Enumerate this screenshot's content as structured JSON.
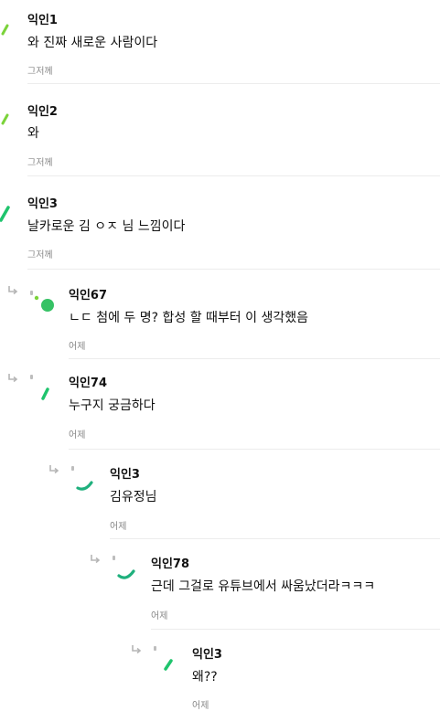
{
  "comments": [
    {
      "author": "익인1",
      "text": "와 진짜 새로운 사람이다",
      "time": "그저께",
      "depth": 0,
      "avatar_color": "#7bd33a"
    },
    {
      "author": "익인2",
      "text": "와",
      "time": "그저께",
      "depth": 0,
      "avatar_color": "#7bd33a"
    },
    {
      "author": "익인3",
      "text": "날카로운 김 ㅇㅈ 님 느낌이다",
      "time": "그저께",
      "depth": 0,
      "avatar_color": "#1fc46d"
    },
    {
      "author": "익인67",
      "text": "ㄴㄷ 첨에 두 명? 합성 할 때부터 이 생각했음",
      "time": "어제",
      "depth": 1,
      "avatar_color": "#36c265"
    },
    {
      "author": "익인74",
      "text": "누구지 궁금하다",
      "time": "어제",
      "depth": 1,
      "avatar_color": "#1fc46d"
    },
    {
      "author": "익인3",
      "text": "김유정님",
      "time": "어제",
      "depth": 2,
      "avatar_color": "#1fb07d"
    },
    {
      "author": "익인78",
      "text": "근데 그걸로 유튜브에서 싸움났더라ㅋㅋㅋ",
      "time": "어제",
      "depth": 3,
      "avatar_color": "#1fb07d"
    },
    {
      "author": "익인3",
      "text": "왜??",
      "time": "어제",
      "depth": 4,
      "avatar_color": "#1fc46d"
    }
  ],
  "colors": {
    "text": "#111111",
    "timestamp": "#888888",
    "divider": "#ececec",
    "reply_arrow": "#b5b5b5"
  },
  "icons": {
    "reply": "reply-arrow-icon",
    "avatar": "avatar-icon"
  }
}
